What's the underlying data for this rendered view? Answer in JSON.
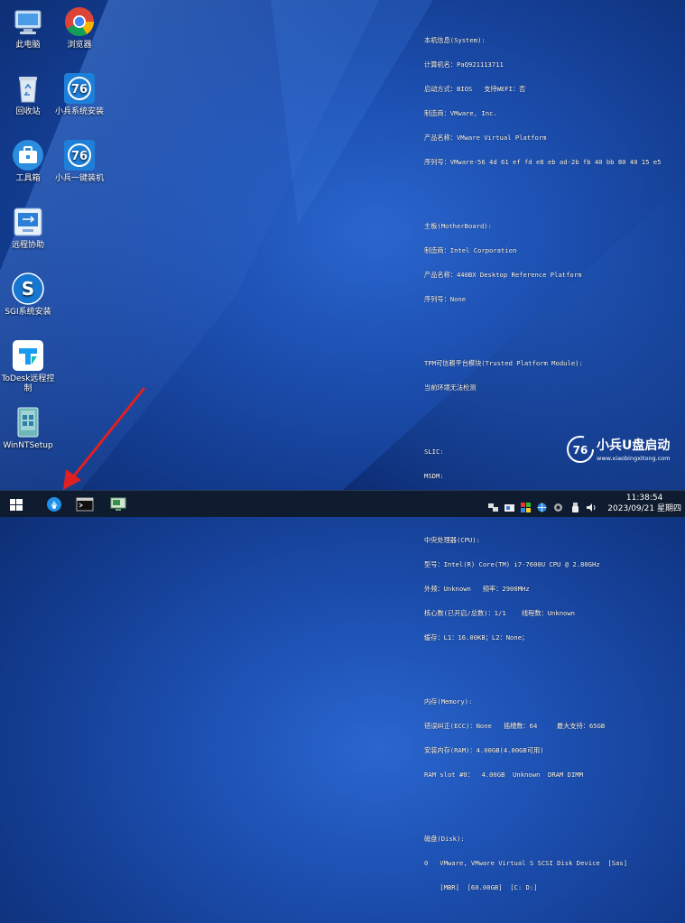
{
  "desktop_icons": [
    {
      "label": "此电脑",
      "icon": "computer-icon"
    },
    {
      "label": "浏览器",
      "icon": "chrome-icon"
    },
    {
      "label": "回收站",
      "icon": "recycle-bin-icon"
    },
    {
      "label": "小兵系统安装",
      "icon": "xiaobing-installer-icon"
    },
    {
      "label": "工具箱",
      "icon": "toolbox-icon"
    },
    {
      "label": "小兵一键装机",
      "icon": "xiaobing-oneclick-icon"
    },
    {
      "label": "远程协助",
      "icon": "remote-assist-icon"
    },
    {
      "label": "SGI系统安装",
      "icon": "sgi-icon"
    },
    {
      "label": "ToDesk远程控制",
      "icon": "todesk-icon"
    },
    {
      "label": "WinNTSetup",
      "icon": "winntsetup-icon"
    }
  ],
  "sysinfo": {
    "system": [
      "本机信息(System):",
      "计算机名：PaQ921113711",
      "启动方式：BIOS   支持WEFI：否",
      "制造商：VMware, Inc.",
      "产品名称：VMware Virtual Platform",
      "序列号：VMware-56 4d 61 ef fd e8 eb ad-2b fb 40 bb 80 40 15 e5"
    ],
    "motherboard": [
      "主板(MotherBoard):",
      "制造商：Intel Corporation",
      "产品名称：440BX Desktop Reference Platform",
      "序列号：None"
    ],
    "tpm": [
      "TPM可信赖平台模块(Trusted Platform Module):",
      "当前环境无法检测"
    ],
    "slic": [
      "SLIC:",
      "MSDM:"
    ],
    "cpu": [
      "中央处理器(CPU):",
      "型号：Intel(R) Core(TM) i7-7600U CPU @ 2.80GHz",
      "外频：Unknown   频率：2900MHz",
      "核心数(已开启/总数)：1/1    线程数：Unknown",
      "缓存：L1：16.00KB；L2：None；"
    ],
    "memory": [
      "内存(Memory):",
      "错误纠正(ECC)：None   插槽数：64     最大支持：65GB",
      "安装内存(RAM)：4.00GB(4.00GB可用)",
      "RAM slot #0：  4.00GB  Unknown  DRAM DIMM"
    ],
    "disk": [
      "磁盘(Disk):",
      "0   VMware, VMware Virtual S SCSI Disk Device  [Sas]",
      "    [MBR]  [60.00GB]  [C: D:]"
    ]
  },
  "brand": {
    "name": "小兵U盘启动",
    "url": "www.xiaobingxitong.com"
  },
  "taskbar": {
    "clock_time": "11:38:54",
    "clock_date": "2023/09/21 星期四",
    "buttons": [
      "start-button",
      "xiaobing-taskbar-button",
      "cmd-taskbar-button",
      "app-taskbar-button"
    ]
  }
}
